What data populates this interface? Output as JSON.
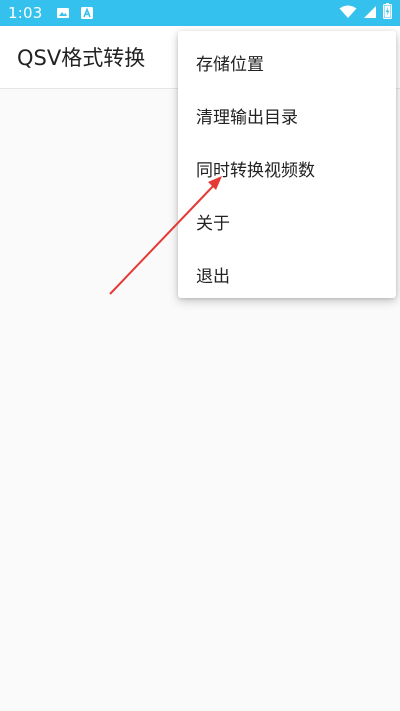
{
  "status_bar": {
    "time": "1:03",
    "bg_color": "#35c1ee",
    "icons_left": [
      "image-icon",
      "text-a-icon"
    ],
    "icons_right": [
      "wifi-icon",
      "signal-icon",
      "battery-icon"
    ]
  },
  "app_bar": {
    "title": "QSV格式转换"
  },
  "menu": {
    "items": [
      {
        "label": "存储位置"
      },
      {
        "label": "清理输出目录"
      },
      {
        "label": "同时转换视频数"
      },
      {
        "label": "关于"
      },
      {
        "label": "退出"
      }
    ]
  },
  "annotation": {
    "color": "#e53935",
    "points_to": "同时转换视频数"
  }
}
